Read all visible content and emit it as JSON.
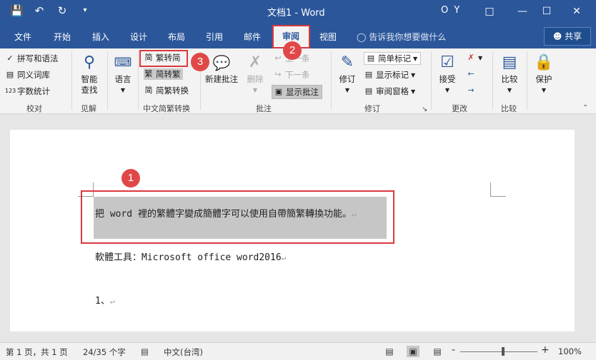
{
  "window": {
    "title": "文档1 - Word",
    "user": "O Y",
    "qat": [
      "save-icon",
      "undo-icon",
      "redo-icon",
      "customize-icon"
    ]
  },
  "tabs": [
    "文件",
    "开始",
    "插入",
    "设计",
    "布局",
    "引用",
    "邮件",
    "审阅",
    "视图"
  ],
  "active_tab": "审阅",
  "tell_me": "告诉我你想要做什么",
  "share": "共享",
  "ribbon": {
    "proofing": {
      "spell": "拼写和语法",
      "thesaurus": "同义词库",
      "wordcount": "字数统计",
      "label": "校对"
    },
    "insights": {
      "smart": "智能\n查找",
      "smart1": "智能",
      "smart2": "查找",
      "label": "见解"
    },
    "language": {
      "lang": "语言",
      "label": "语言"
    },
    "chinese": {
      "t2s": "繁转简",
      "s2t": "简转繁",
      "convert": "简繁转换",
      "label": "中文简繁转换"
    },
    "comments": {
      "new": "新建批注",
      "delete": "删除",
      "prev": "上一条",
      "next": "下一条",
      "show": "显示批注",
      "label": "批注"
    },
    "tracking": {
      "track": "修订",
      "markup": "简单标记",
      "showmarkup": "显示标记",
      "pane": "审阅窗格",
      "label": "修订"
    },
    "changes": {
      "accept": "接受",
      "label": "更改"
    },
    "compare": {
      "compare": "比较",
      "label": "比较"
    },
    "protect": {
      "protect": "保护"
    }
  },
  "document": {
    "line1": "把 word 裡的繁體字變成簡體字可以使用自帶簡繁轉換功能。",
    "line2": "軟體工具：Microsoft office word2016",
    "line3": "1、"
  },
  "badges": {
    "b1": "1",
    "b2": "2",
    "b3": "3"
  },
  "status": {
    "page": "第 1 页，共 1 页",
    "words": "24/35 个字",
    "lang": "中文(台湾)",
    "zoom": "100%",
    "zoom_minus": "-",
    "zoom_plus": "+"
  }
}
